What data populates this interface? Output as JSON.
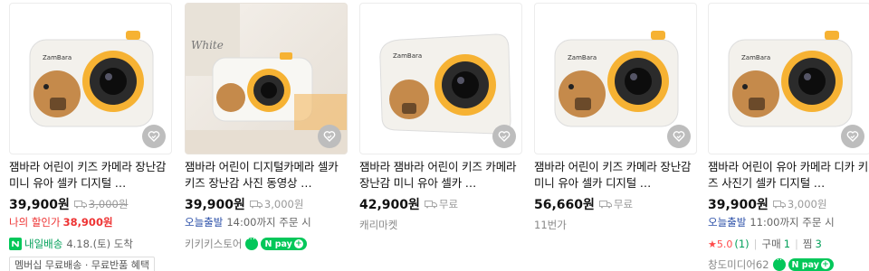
{
  "products": [
    {
      "image_alt": "ZamBara",
      "title": "잼바라 어린이 키즈 카메라 장난감 미니 유아 셀카 디지털 …",
      "price": "39,900원",
      "shipping": "3,000원",
      "shipping_struck": true,
      "discount_label": "나의 할인가",
      "discount_price": "38,900원",
      "delivery_badge": "내일배송",
      "delivery_text": "4.18.(토) 도착",
      "tag": "멤버십 무료배송 · 무료반품 혜택"
    },
    {
      "image_alt": "White",
      "title": "잼바라 어린이 디지털카메라 셀카 키즈 장난감 사진 동영상 …",
      "price": "39,900원",
      "shipping": "3,000원",
      "shipping_struck": false,
      "today_label": "오늘출발",
      "today_text": "14:00까지 주문 시",
      "store": "키키키스토어",
      "npay": "N pay"
    },
    {
      "image_alt": "ZamBara",
      "title": "잼바라 잼바라 어린이 키즈 카메라 장난감 미니 유아 셀카 …",
      "price": "42,900원",
      "shipping": "무료",
      "shipping_struck": false,
      "store": "캐리마켓"
    },
    {
      "image_alt": "ZamBara",
      "title": "잼바라 어린이 키즈 카메라 장난감 미니 유아 셀카 디지털 …",
      "price": "56,660원",
      "shipping": "무료",
      "shipping_struck": false,
      "store": "11번가"
    },
    {
      "image_alt": "ZamBara",
      "title": "잼바라 어린이 유아 카메라 디카 키즈 사진기 셀카 디지털 …",
      "price": "39,900원",
      "shipping": "3,000원",
      "shipping_struck": false,
      "today_label": "오늘출발",
      "today_text": "11:00까지 주문 시",
      "rating": "★5.0",
      "rating_count": "(1)",
      "purchase_label": "구매",
      "purchase_count": "1",
      "zzim_label": "찜",
      "zzim_count": "3",
      "store": "창도미디어62",
      "npay": "N pay"
    }
  ],
  "colors": {
    "camera_body": "#f3f1ec",
    "camera_orange": "#f6b233",
    "capybara": "#c58a4b",
    "discount": "#e33333",
    "naver_green": "#03c75a",
    "today_blue": "#2b4fa8"
  },
  "icons": {
    "zzim": "heart-check-icon",
    "shipping": "truck-icon",
    "talk": "chat-icon"
  }
}
